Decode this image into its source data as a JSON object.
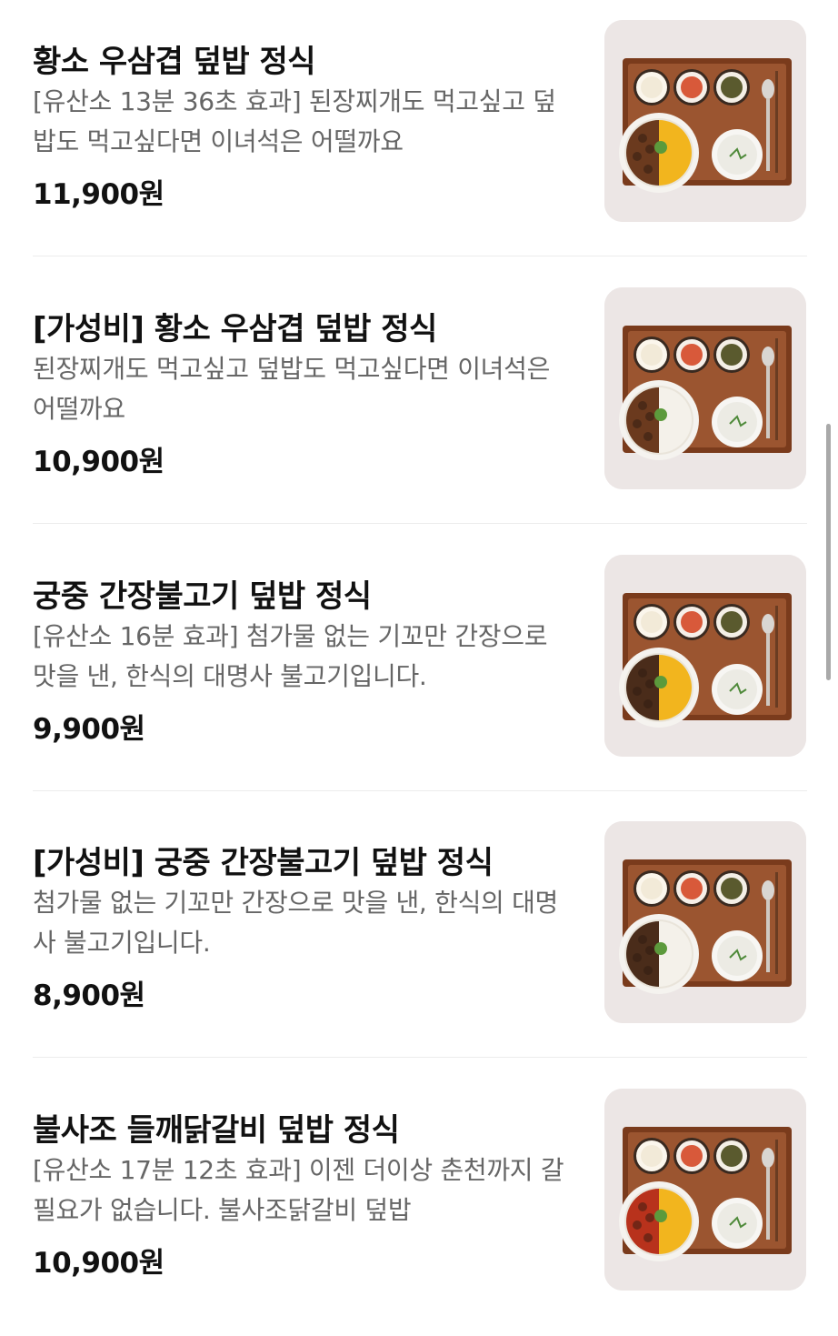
{
  "menu": {
    "items": [
      {
        "title": "황소 우삼겹 덮밥 정식",
        "description": "[유산소 13분 36초 효과] 된장찌개도 먹고싶고 덮밥도 먹고싶다면 이녀석은 어떨까요",
        "price": "11,900원",
        "rice": "omelet",
        "meat": "beef-brisket"
      },
      {
        "title": "[가성비] 황소 우삼겹 덮밥 정식",
        "description": "된장찌개도 먹고싶고 덮밥도 먹고싶다면 이녀석은 어떨까요",
        "price": "10,900원",
        "rice": "white",
        "meat": "beef-brisket"
      },
      {
        "title": "궁중 간장불고기 덮밥 정식",
        "description": "[유산소 16분 효과] 첨가물 없는 기꼬만 간장으로 맛을 낸, 한식의 대명사 불고기입니다.",
        "price": "9,900원",
        "rice": "omelet",
        "meat": "bulgogi"
      },
      {
        "title": "[가성비] 궁중 간장불고기 덮밥 정식",
        "description": "첨가물 없는 기꼬만 간장으로 맛을 낸, 한식의 대명사 불고기입니다.",
        "price": "8,900원",
        "rice": "white",
        "meat": "bulgogi"
      },
      {
        "title": "불사조 들깨닭갈비 덮밥 정식",
        "description": "[유산소 17분 12초 효과] 이젠 더이상 춘천까지 갈 필요가 없습니다. 불사조닭갈비 덮밥",
        "price": "10,900원",
        "rice": "omelet",
        "meat": "dakgalbi"
      }
    ]
  },
  "colors": {
    "tray": "#7a3b1c",
    "tray_inner": "#9b5530",
    "thumb_bg": "#ece6e5",
    "text": "#111111",
    "desc": "#666666",
    "divider": "#ececec"
  }
}
